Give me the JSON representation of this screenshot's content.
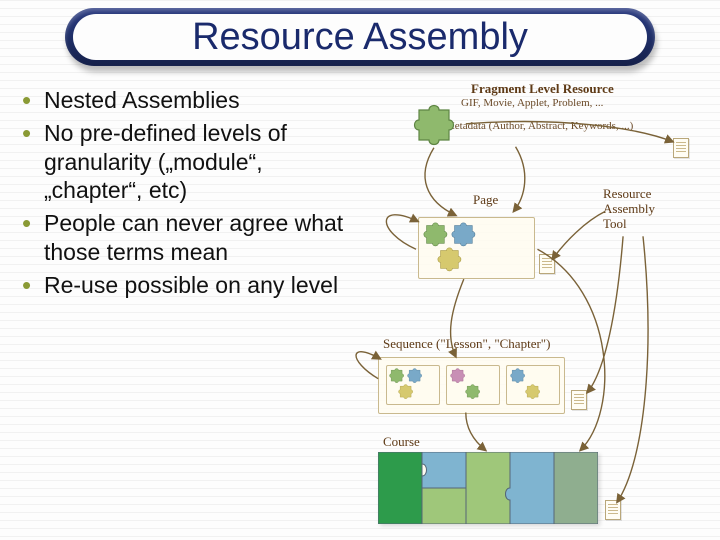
{
  "title": "Resource Assembly",
  "bullets": [
    "Nested Assemblies",
    "No pre-defined levels of granularity („module“, „chapter“, etc)",
    "People can never agree what those terms mean",
    "Re-use possible on any level"
  ],
  "diagram": {
    "fragment_label": "Fragment Level Resource",
    "fragment_sub": "GIF, Movie, Applet, Problem, ...",
    "metadata_label": "Metadata (Author, Abstract, Keywords, ...)",
    "page_label": "Page",
    "rat_label": "Resource\nAssembly\nTool",
    "sequence_label": "Sequence (\"Lesson\", \"Chapter\")",
    "course_label": "Course"
  }
}
